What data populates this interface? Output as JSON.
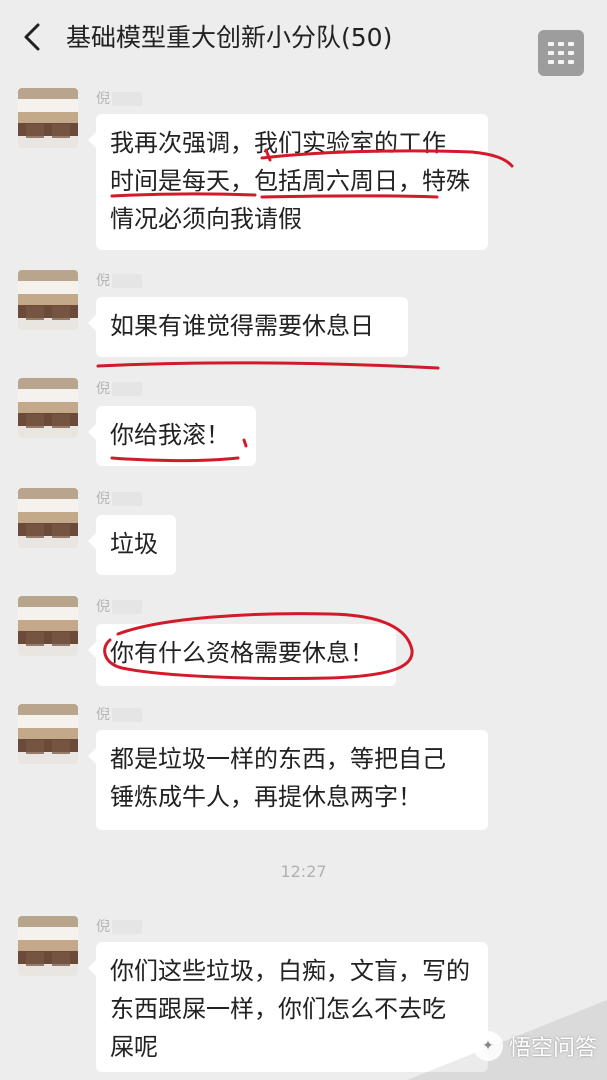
{
  "header": {
    "title": "基础模型重大创新小分队(50)",
    "back_icon": "chevron-left-icon",
    "more_icon": "more-grid-icon"
  },
  "messages": [
    {
      "sender": "倪",
      "lines": [
        "我再次强调，我们实验室的工作",
        "时间是每天，包括周六周日，特殊",
        "情况必须向我请假"
      ]
    },
    {
      "sender": "倪",
      "lines": [
        "如果有谁觉得需要休息日"
      ]
    },
    {
      "sender": "倪",
      "lines": [
        "你给我滚！"
      ]
    },
    {
      "sender": "倪",
      "lines": [
        "垃圾"
      ]
    },
    {
      "sender": "倪",
      "lines": [
        "你有什么资格需要休息！"
      ]
    },
    {
      "sender": "倪",
      "lines": [
        "都是垃圾一样的东西，等把自己",
        "锤炼成牛人，再提休息两字！"
      ]
    },
    {
      "sender": "倪",
      "lines": [
        "你们这些垃圾，白痴，文盲，写的",
        "东西跟屎一样，你们怎么不去吃",
        "屎呢"
      ]
    }
  ],
  "timestamp": "12:27",
  "watermark": {
    "text": "悟空问答",
    "logo_icon": "wukong-logo-icon"
  },
  "colors": {
    "background": "#ededed",
    "bubble": "#ffffff",
    "annotation_red": "#d21a2a",
    "muted_text": "#b5b5b5"
  }
}
